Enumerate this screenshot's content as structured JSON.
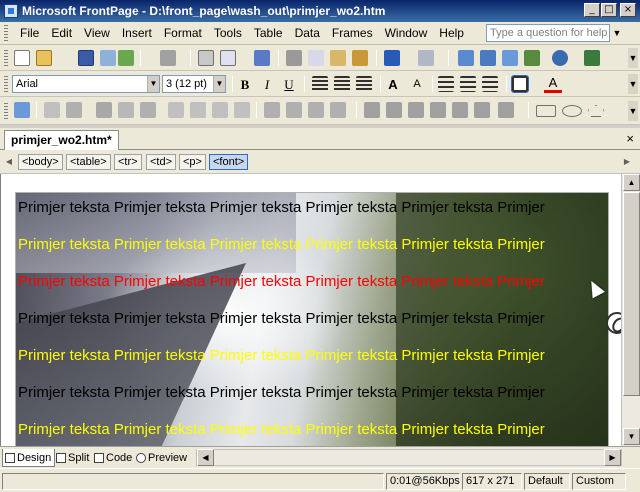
{
  "window": {
    "title": "Microsoft FrontPage - D:\\front_page\\wash_out\\primjer_wo2.htm",
    "minimize": "_",
    "maximize": "□",
    "close": "×"
  },
  "menu": {
    "items": [
      "File",
      "Edit",
      "View",
      "Insert",
      "Format",
      "Tools",
      "Table",
      "Data",
      "Frames",
      "Window",
      "Help"
    ],
    "help_placeholder": "Type a question for help"
  },
  "formatting": {
    "font": "Arial",
    "size": "3  (12 pt)",
    "bold": "B",
    "italic": "I",
    "underline": "U"
  },
  "document": {
    "tab_label": "primjer_wo2.htm*",
    "close": "×"
  },
  "tag_bar": [
    "<body>",
    "<table>",
    "<tr>",
    "<td>",
    "<p>",
    "<font>"
  ],
  "content": {
    "lines": [
      {
        "text": "Primjer teksta Primjer teksta Primjer teksta Primjer teksta Primjer teksta Primjer",
        "color": "#000000"
      },
      {
        "text": "Primjer teksta Primjer teksta Primjer teksta Primjer teksta Primjer teksta Primjer",
        "color": "#ffff00"
      },
      {
        "text": "Primjer teksta Primjer teksta Primjer teksta Primjer teksta Primjer teksta Primjer",
        "color": "#ff0000"
      },
      {
        "text": "Primjer teksta Primjer teksta Primjer teksta Primjer teksta Primjer teksta Primjer",
        "color": "#000000"
      },
      {
        "text": "Primjer teksta Primjer teksta Primjer teksta Primjer teksta Primjer teksta Primjer",
        "color": "#ffff00"
      },
      {
        "text": "Primjer teksta Primjer teksta Primjer teksta Primjer teksta Primjer teksta Primjer",
        "color": "#000000"
      },
      {
        "text": "Primjer teksta Primjer teksta Primjer teksta Primjer teksta Primjer teksta Primjer",
        "color": "#ffff00"
      }
    ]
  },
  "view_tabs": [
    "Design",
    "Split",
    "Code",
    "Preview"
  ],
  "status": {
    "download_time": "0:01@56Kbps",
    "dimensions": "617 x 271",
    "default_label": "Default",
    "custom_label": "Custom"
  },
  "colors": {
    "title_bar": "#0a246a",
    "toolbar": "#ece9d8",
    "accent": "#316ac5"
  }
}
